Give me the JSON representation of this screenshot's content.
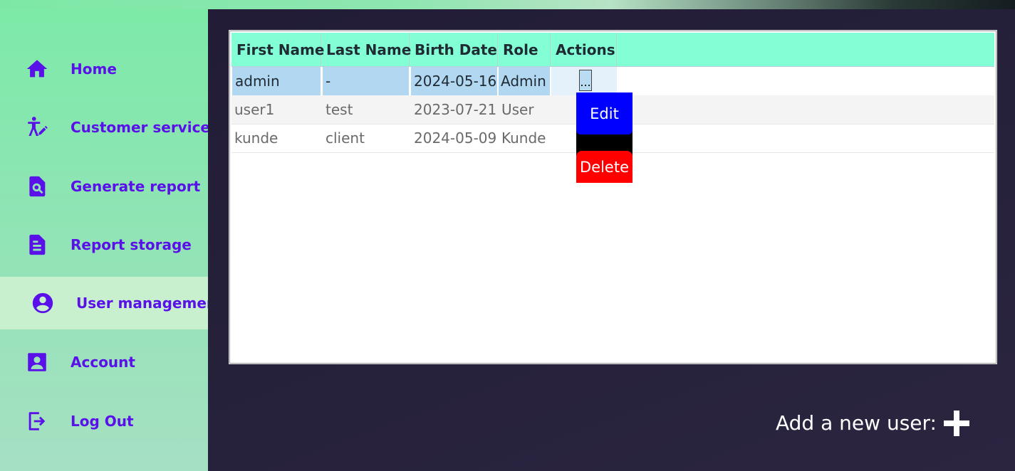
{
  "sidebar": {
    "items": [
      {
        "label": "Home",
        "icon": "home-icon"
      },
      {
        "label": "Customer service",
        "icon": "accessibility-edit-icon"
      },
      {
        "label": "Generate report",
        "icon": "file-search-icon"
      },
      {
        "label": "Report storage",
        "icon": "document-icon"
      },
      {
        "label": "User management",
        "icon": "user-circle-icon",
        "active": true
      },
      {
        "label": "Account",
        "icon": "account-box-icon"
      },
      {
        "label": "Log Out",
        "icon": "logout-icon"
      }
    ]
  },
  "table": {
    "columns": [
      "First Name",
      "Last Name",
      "Birth Date",
      "Role",
      "Actions"
    ],
    "rows": [
      {
        "first": "admin",
        "last": "-",
        "birth": "2024-05-16",
        "role": "Admin",
        "action": "..."
      },
      {
        "first": "user1",
        "last": "test",
        "birth": "2023-07-21",
        "role": "User",
        "action": ""
      },
      {
        "first": "kunde",
        "last": "client",
        "birth": "2024-05-09",
        "role": "Kunde",
        "action": ""
      }
    ]
  },
  "popup": {
    "edit_label": "Edit",
    "delete_label": "Delete"
  },
  "footer": {
    "add_label": "Add a new user:"
  },
  "colors": {
    "accent": "#5a10e8",
    "header_bg": "#82ffd5",
    "edit_bg": "#0000ff",
    "delete_bg": "#ff0000",
    "selection": "#b2d7f1"
  }
}
